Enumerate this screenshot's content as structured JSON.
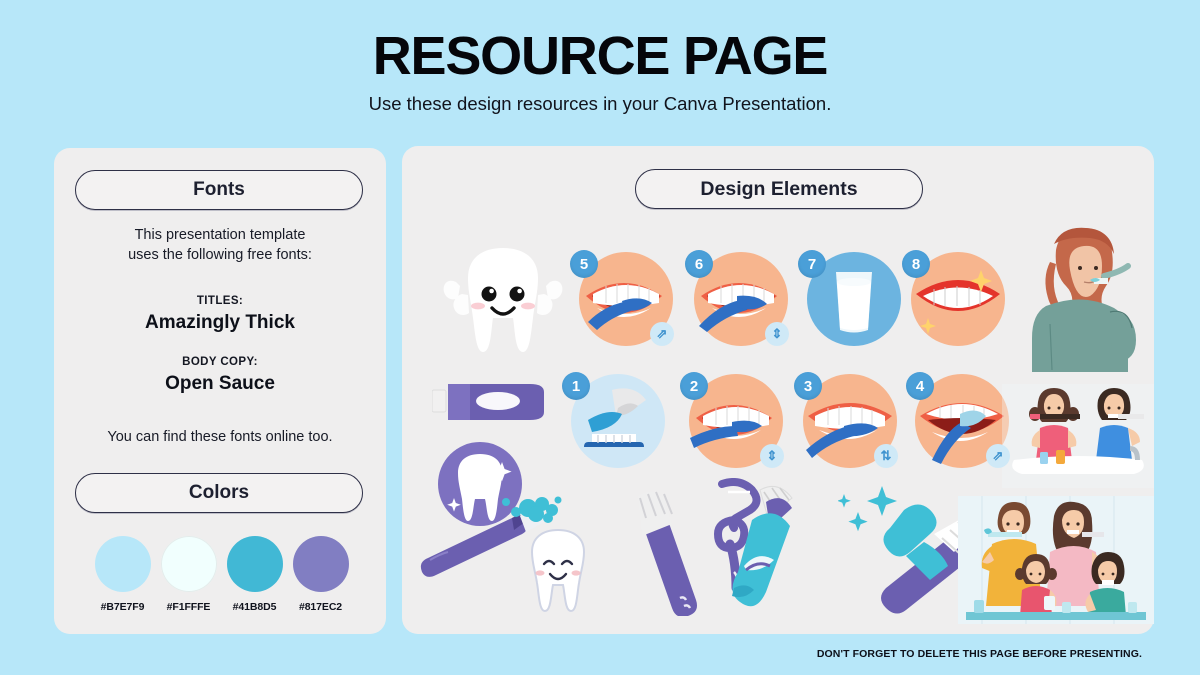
{
  "header": {
    "title": "RESOURCE PAGE",
    "subtitle": "Use these design resources in your Canva Presentation."
  },
  "fonts_panel": {
    "pill_label": "Fonts",
    "intro": "This presentation template\nuses the following free fonts:",
    "titles_label": "TITLES:",
    "titles_font": "Amazingly Thick",
    "body_label": "BODY COPY:",
    "body_font": "Open Sauce",
    "outro": "You can find these fonts online too."
  },
  "colors_panel": {
    "pill_label": "Colors",
    "swatches": [
      {
        "hex": "#B7E7F9",
        "name": "light-blue"
      },
      {
        "hex": "#F1FFFE",
        "name": "off-white"
      },
      {
        "hex": "#41B8D5",
        "name": "cyan"
      },
      {
        "hex": "#817EC2",
        "name": "purple"
      }
    ]
  },
  "design_elements": {
    "pill_label": "Design Elements",
    "numbered_steps": [
      {
        "number": "5",
        "scene": "mouth-brushing-side",
        "bg": "#f7b58e"
      },
      {
        "number": "6",
        "scene": "mouth-brushing-inner",
        "bg": "#f7b58e"
      },
      {
        "number": "7",
        "scene": "glass-of-milk",
        "bg": "#6cb4e0"
      },
      {
        "number": "8",
        "scene": "sparkling-smile",
        "bg": "#f7b58e"
      },
      {
        "number": "1",
        "scene": "toothbrush-with-paste",
        "bg": "#cfe7f6"
      },
      {
        "number": "2",
        "scene": "mouth-brushing-front",
        "bg": "#f7b58e"
      },
      {
        "number": "3",
        "scene": "mouth-brushing-horizontal",
        "bg": "#f7b58e"
      },
      {
        "number": "4",
        "scene": "mouth-brushing-upward",
        "bg": "#f7b58e"
      }
    ],
    "illustrations": [
      "happy-tooth-mascot",
      "purple-toothpaste-tube",
      "tooth-in-purple-circle",
      "toothbrush-with-foam",
      "smiling-tooth",
      "purple-toothbrush",
      "floss-pick",
      "cyan-toothpaste-tube",
      "toothbrush-with-cyan-paste",
      "woman-brushing-teeth",
      "two-kids-brushing-at-sink",
      "family-brushing-teeth"
    ]
  },
  "footer": {
    "note": "DON'T FORGET TO DELETE THIS PAGE BEFORE PRESENTING."
  },
  "theme": {
    "background": "#B7E7F9",
    "panel": "#EFEEEE",
    "ink": "#1D2030"
  }
}
